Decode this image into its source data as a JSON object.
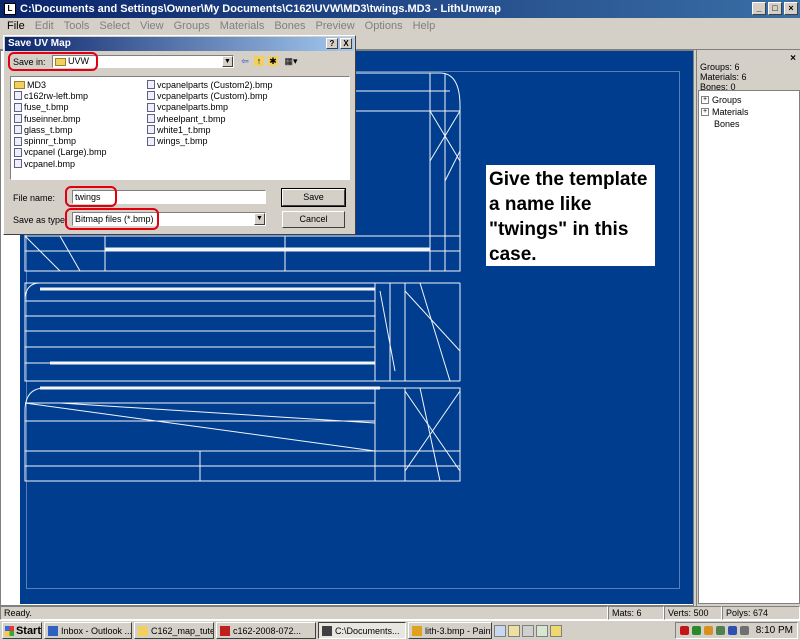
{
  "window": {
    "title": "C:\\Documents and Settings\\Owner\\My Documents\\C162\\UVW\\MD3\\twings.MD3 - LithUnwrap",
    "icon": "app-icon"
  },
  "menu": [
    {
      "label": "File",
      "enabled": true
    },
    {
      "label": "Edit",
      "enabled": false
    },
    {
      "label": "Tools",
      "enabled": false
    },
    {
      "label": "Select",
      "enabled": false
    },
    {
      "label": "View",
      "enabled": false
    },
    {
      "label": "Groups",
      "enabled": false
    },
    {
      "label": "Materials",
      "enabled": false
    },
    {
      "label": "Bones",
      "enabled": false
    },
    {
      "label": "Preview",
      "enabled": false
    },
    {
      "label": "Options",
      "enabled": false
    },
    {
      "label": "Help",
      "enabled": false
    }
  ],
  "right_panel": {
    "stats": [
      "Groups: 6",
      "Materials: 6",
      "Bones: 0"
    ],
    "tree": [
      {
        "label": "Groups",
        "expander": "+"
      },
      {
        "label": "Materials",
        "expander": "+"
      },
      {
        "label": "Bones",
        "expander": ""
      }
    ]
  },
  "annotation": "Give the template a name like \"twings\" in this case.",
  "dialog": {
    "title": "Save UV Map",
    "help_btn": "?",
    "close_btn": "X",
    "save_in_label": "Save in:",
    "save_in_value": "UVW",
    "files_col1": [
      {
        "name": "MD3",
        "type": "folder"
      },
      {
        "name": "c162rw-left.bmp",
        "type": "file"
      },
      {
        "name": "fuse_t.bmp",
        "type": "file"
      },
      {
        "name": "fuseinner.bmp",
        "type": "file"
      },
      {
        "name": "glass_t.bmp",
        "type": "file"
      },
      {
        "name": "spinnr_t.bmp",
        "type": "file"
      },
      {
        "name": "vcpanel (Large).bmp",
        "type": "file"
      },
      {
        "name": "vcpanel.bmp",
        "type": "file"
      }
    ],
    "files_col2": [
      {
        "name": "vcpanelparts (Custom2).bmp",
        "type": "file"
      },
      {
        "name": "vcpanelparts (Custom).bmp",
        "type": "file"
      },
      {
        "name": "vcpanelparts.bmp",
        "type": "file"
      },
      {
        "name": "wheelpant_t.bmp",
        "type": "file"
      },
      {
        "name": "white1_t.bmp",
        "type": "file"
      },
      {
        "name": "wings_t.bmp",
        "type": "file"
      }
    ],
    "filename_label": "File name:",
    "filename_value": "twings",
    "savetype_label": "Save as type:",
    "savetype_value": "Bitmap files (*.bmp)",
    "save_button": "Save",
    "cancel_button": "Cancel"
  },
  "status": {
    "ready": "Ready.",
    "mats": "Mats: 6",
    "verts": "Verts: 500",
    "polys": "Polys: 674"
  },
  "taskbar": {
    "start": "Start",
    "tasks": [
      {
        "label": "Inbox - Outlook ...",
        "active": false
      },
      {
        "label": "C162_map_tute",
        "active": false
      },
      {
        "label": "c162-2008-072...",
        "active": false
      },
      {
        "label": "C:\\Documents...",
        "active": true
      },
      {
        "label": "lith-3.bmp - Paint",
        "active": false
      }
    ],
    "clock": "8:10 PM"
  },
  "colors": {
    "uv_background": "#003d8f",
    "highlight_red": "#e00010",
    "title_blue": "#0a246a"
  }
}
